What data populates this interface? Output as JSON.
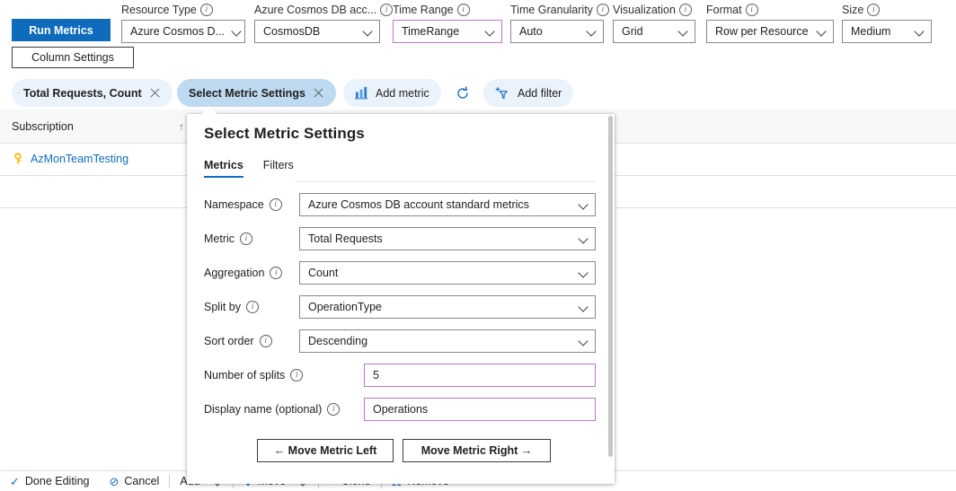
{
  "toolbar": {
    "run_metrics_label": "Run Metrics",
    "column_settings_label": "Column Settings",
    "fields": [
      {
        "label": "Resource Type",
        "value": "Azure Cosmos D...",
        "accent": false
      },
      {
        "label": "Azure Cosmos DB acc...",
        "value": "CosmosDB",
        "accent": false
      },
      {
        "label": "Time Range",
        "value": "TimeRange",
        "accent": true
      },
      {
        "label": "Time Granularity",
        "value": "Auto",
        "accent": false
      },
      {
        "label": "Visualization",
        "value": "Grid",
        "accent": false
      },
      {
        "label": "Format",
        "value": "Row per Resource",
        "accent": false
      },
      {
        "label": "Size",
        "value": "Medium",
        "accent": false
      }
    ]
  },
  "chips": [
    {
      "label": "Total Requests, Count",
      "selected": false,
      "closable": true,
      "icon": ""
    },
    {
      "label": "Select Metric Settings",
      "selected": true,
      "closable": true,
      "icon": ""
    },
    {
      "label": "Add metric",
      "selected": false,
      "closable": false,
      "icon": "bar-chart-icon"
    },
    {
      "label": "",
      "selected": false,
      "closable": false,
      "icon": "refresh-icon"
    },
    {
      "label": "Add filter",
      "selected": false,
      "closable": false,
      "icon": "add-filter-icon"
    }
  ],
  "grid": {
    "header": {
      "subscription": "Subscription",
      "sort_indicator": "↑"
    },
    "rows": [
      {
        "name": "AzMonTeamTesting",
        "icon": "key-icon"
      }
    ]
  },
  "bottom_bar": {
    "items": [
      {
        "label": "Done Editing",
        "icon": "✓"
      },
      {
        "label": "Cancel",
        "icon": "⊘"
      },
      {
        "label": "Add",
        "icon": "",
        "caret": "∨"
      },
      {
        "label": "Move",
        "icon": "⬇",
        "caret": "∨"
      },
      {
        "label": "Clone",
        "icon": "⑅",
        "caret": ""
      },
      {
        "label": "Remove",
        "icon": "☷",
        "caret": ""
      }
    ]
  },
  "panel": {
    "title": "Select Metric Settings",
    "tabs": [
      {
        "label": "Metrics",
        "active": true
      },
      {
        "label": "Filters",
        "active": false
      }
    ],
    "rows": [
      {
        "label": "Namespace",
        "value": "Azure Cosmos DB account standard metrics",
        "control": "dropdown",
        "accent": false
      },
      {
        "label": "Metric",
        "value": "Total Requests",
        "control": "dropdown",
        "accent": false
      },
      {
        "label": "Aggregation",
        "value": "Count",
        "control": "dropdown",
        "accent": false
      },
      {
        "label": "Split by",
        "value": "OperationType",
        "control": "dropdown",
        "accent": false
      },
      {
        "label": "Sort order",
        "value": "Descending",
        "control": "dropdown",
        "accent": false
      },
      {
        "label": "Number of splits",
        "value": "5",
        "control": "text",
        "accent": true
      },
      {
        "label": "Display name (optional)",
        "value": "Operations",
        "control": "text",
        "accent": true
      }
    ],
    "move_left_label": "←  Move Metric Left",
    "move_right_label": "Move Metric Right  →"
  },
  "colors": {
    "accent_blue": "#0f6cbd",
    "chip_bg": "#eaf2fb",
    "chip_selected_bg": "#bedaf1",
    "accent_purple": "#b57ac4",
    "key_yellow": "#ffb900"
  }
}
